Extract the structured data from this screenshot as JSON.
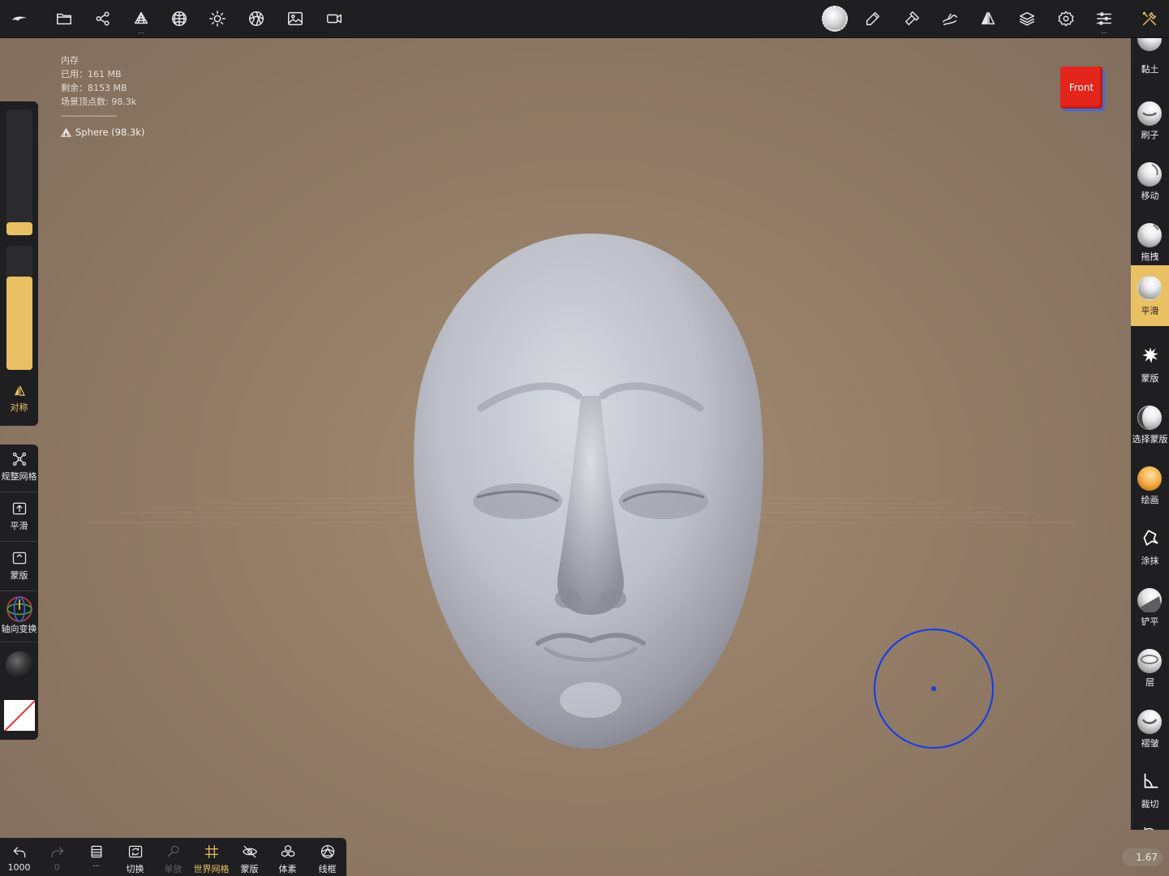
{
  "topbar": {
    "left_icons": [
      "logo-icon",
      "folder-icon",
      "scene-graph-icon",
      "topology-icon",
      "material-sphere-icon",
      "light-icon",
      "shading-icon",
      "background-image-icon",
      "camera-icon"
    ],
    "right_icons": [
      "active-brush-icon",
      "brush-pen-icon",
      "hammer-icon",
      "sculpt-stroke-icon",
      "symmetry-icon",
      "layers-icon",
      "settings-icon",
      "sliders-icon",
      "tools-icon"
    ]
  },
  "info": {
    "title": "内存",
    "used": "已用：161 MB",
    "free": "剩余：8153 MB",
    "vertices": "场景顶点数: 98.3k",
    "separator": "-----------------------",
    "mesh": "Sphere (98.3k)"
  },
  "left_panel": {
    "radius_level": 0.1,
    "intensity_level": 0.75,
    "symmetry_label": "对称",
    "items": [
      {
        "label": "规整网格"
      },
      {
        "label": "平滑"
      },
      {
        "label": "蒙版"
      },
      {
        "label": "轴向变换"
      }
    ]
  },
  "right_panel": {
    "tools": [
      {
        "label": "黏土",
        "active": false
      },
      {
        "label": "刷子",
        "active": false
      },
      {
        "label": "移动",
        "active": false
      },
      {
        "label": "拖拽",
        "active": false
      },
      {
        "label": "平滑",
        "active": true
      },
      {
        "label": "蒙版",
        "active": false
      },
      {
        "label": "选择蒙版",
        "active": false
      },
      {
        "label": "绘画",
        "active": false
      },
      {
        "label": "涂抹",
        "active": false
      },
      {
        "label": "铲平",
        "active": false
      },
      {
        "label": "层",
        "active": false
      },
      {
        "label": "褶皱",
        "active": false
      },
      {
        "label": "裁切",
        "active": false
      }
    ]
  },
  "viewcube": {
    "label": "Front"
  },
  "bottombar": {
    "undo_count": "1000",
    "redo_count": "0",
    "items": [
      {
        "label": "切换"
      },
      {
        "label": "单放"
      },
      {
        "label": "世界网格"
      },
      {
        "label": "蒙版"
      },
      {
        "label": "体素"
      },
      {
        "label": "线框"
      }
    ]
  },
  "scale_value": "1.67",
  "colors": {
    "accent": "#e9c064",
    "panel": "#1f1f21",
    "viewcube": "#e4251c",
    "brush_cursor": "#1a3fe0"
  }
}
